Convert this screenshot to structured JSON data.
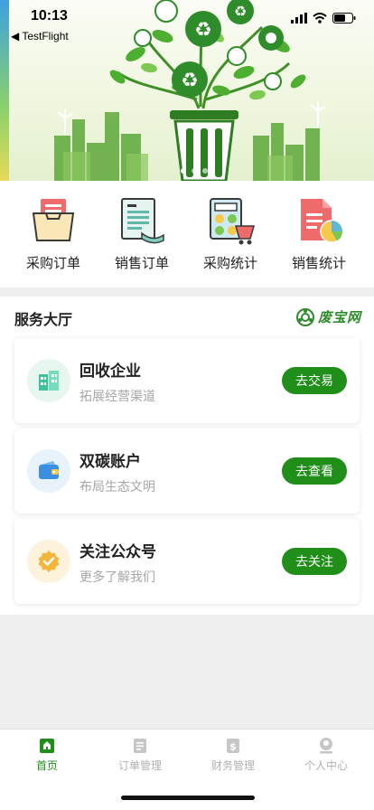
{
  "status_bar": {
    "time": "10:13",
    "back_label": "◀ TestFlight"
  },
  "banner": {
    "icon": "recycling-bin-tree-illustration",
    "slide_count": 3,
    "active_slide": 1
  },
  "quick_actions": [
    {
      "label": "采购订单",
      "icon": "purchase-order-icon"
    },
    {
      "label": "销售订单",
      "icon": "sales-order-icon"
    },
    {
      "label": "采购统计",
      "icon": "purchase-stats-icon"
    },
    {
      "label": "销售统计",
      "icon": "sales-stats-icon"
    }
  ],
  "services": {
    "title": "服务大厅",
    "brand": "废宝网",
    "cards": [
      {
        "title": "回收企业",
        "subtitle": "拓展经营渠道",
        "button": "去交易",
        "icon": "building-icon"
      },
      {
        "title": "双碳账户",
        "subtitle": "布局生态文明",
        "button": "去查看",
        "icon": "wallet-icon"
      },
      {
        "title": "关注公众号",
        "subtitle": "更多了解我们",
        "button": "去关注",
        "icon": "badge-check-icon"
      }
    ]
  },
  "tabbar": {
    "items": [
      {
        "label": "首页",
        "icon": "home-icon",
        "active": true
      },
      {
        "label": "订单管理",
        "icon": "order-icon",
        "active": false
      },
      {
        "label": "财务管理",
        "icon": "finance-icon",
        "active": false
      },
      {
        "label": "个人中心",
        "icon": "profile-icon",
        "active": false
      }
    ]
  },
  "colors": {
    "accent": "#1f8f1a",
    "brand": "#2d8c2a",
    "muted": "#a6a6a6"
  }
}
